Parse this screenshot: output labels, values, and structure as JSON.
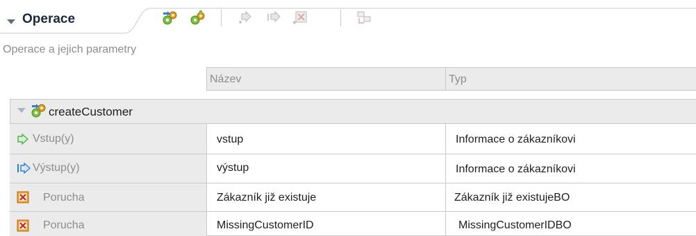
{
  "section": {
    "title": "Operace",
    "description": "Operace a jejich parametry"
  },
  "toolbar": {
    "buttons": [
      {
        "icon": "add-operation-icon",
        "enabled": true
      },
      {
        "icon": "add-request-response-icon",
        "enabled": true
      },
      {
        "icon": "add-input-icon",
        "enabled": false
      },
      {
        "icon": "add-output-icon",
        "enabled": false
      },
      {
        "icon": "add-fault-icon",
        "enabled": false
      },
      {
        "icon": "show-as-table-icon",
        "enabled": false
      }
    ]
  },
  "table": {
    "columns": [
      "Název",
      "Typ"
    ],
    "operation": {
      "name": "createCustomer",
      "icon": "operation-icon"
    },
    "rows": [
      {
        "kind_icon": "input-icon",
        "kind": "Vstup(y)",
        "name": "vstup",
        "type": "Informace o zákazníkovi"
      },
      {
        "kind_icon": "output-icon",
        "kind": "Výstup(y)",
        "name": "výstup",
        "type": "Informace o zákazníkovi"
      },
      {
        "kind_icon": "fault-icon",
        "kind": "Porucha",
        "name": "Zákazník již existuje",
        "type": "Zákazník již existujeBO"
      },
      {
        "kind_icon": "fault-icon",
        "kind": "Porucha",
        "name": "MissingCustomerID",
        "type": "MissingCustomerIDBO"
      }
    ]
  },
  "colors": {
    "header_fill": "#ebebeb",
    "grid_line": "#c9c9c9",
    "muted_text": "#8d8d8d",
    "fault_orange": "#f0a030",
    "input_green": "#4caf50",
    "output_blue": "#2f7fd0"
  }
}
